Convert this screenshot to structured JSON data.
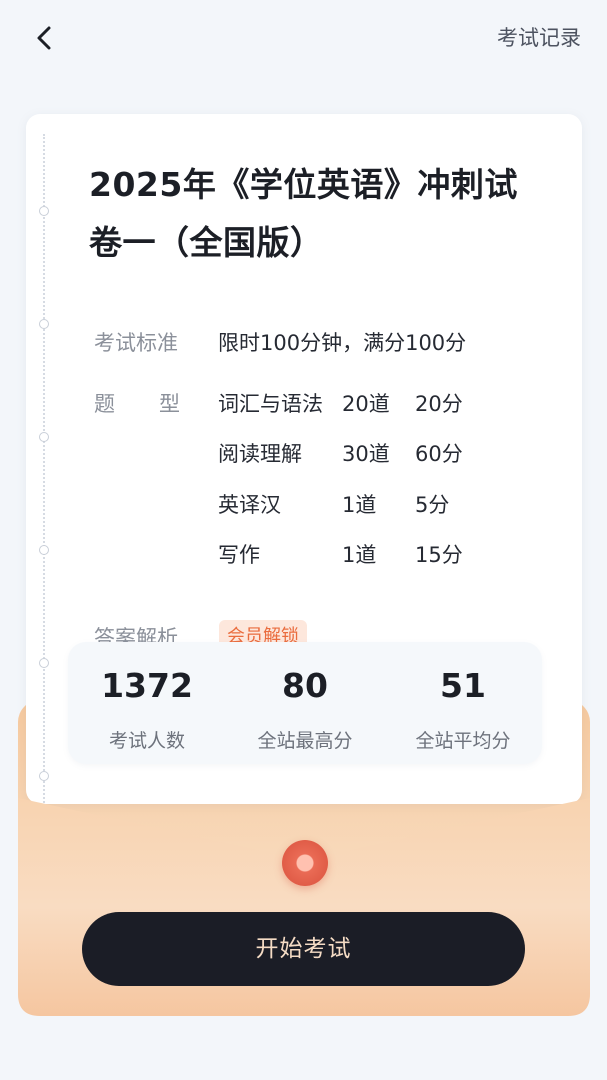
{
  "header": {
    "record_label": "考试记录"
  },
  "exam": {
    "title": "2025年《学位英语》冲刺试卷一（全国版）",
    "standard_label": "考试标准",
    "standard_value": "限时100分钟，满分100分",
    "type_label": "题型",
    "question_types": [
      {
        "name": "词汇与语法",
        "count": "20道",
        "score": "20分"
      },
      {
        "name": "阅读理解",
        "count": "30道",
        "score": "60分"
      },
      {
        "name": "英译汉",
        "count": "1道",
        "score": "5分"
      },
      {
        "name": "写作",
        "count": "1道",
        "score": "15分"
      }
    ],
    "analysis_label": "答案解析",
    "analysis_badge": "会员解锁"
  },
  "stats": [
    {
      "value": "1372",
      "label": "考试人数"
    },
    {
      "value": "80",
      "label": "全站最高分"
    },
    {
      "value": "51",
      "label": "全站平均分"
    }
  ],
  "start_button": "开始考试",
  "colors": {
    "background": "#f3f6fa",
    "button": "#1b1d26",
    "button_text": "#f5dcc5",
    "envelope": "#f6c99e",
    "badge_text": "#ea6c3e",
    "seal": "#e05c47"
  },
  "icons": {
    "back": "chevron-left-icon",
    "seal": "seal-icon"
  }
}
